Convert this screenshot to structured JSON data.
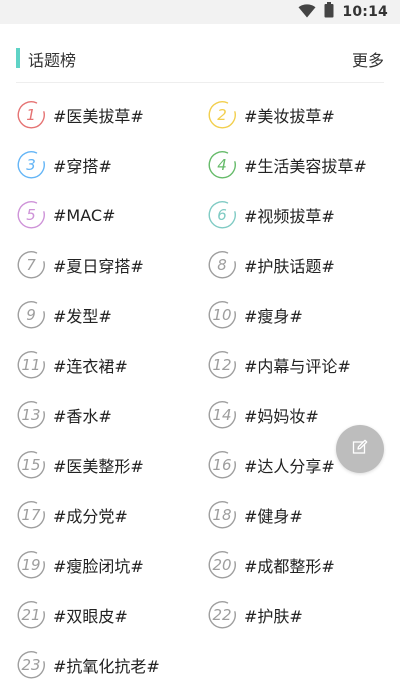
{
  "status_bar": {
    "time": "10:14",
    "icons": [
      "wifi-icon",
      "battery-icon"
    ]
  },
  "header": {
    "title": "话题榜",
    "more_label": "更多",
    "accent_color": "#5fd3c6"
  },
  "topics": [
    {
      "rank": "1",
      "label": "#医美拔草#",
      "color": "#e57373"
    },
    {
      "rank": "2",
      "label": "#美妆拔草#",
      "color": "#f2cf4e"
    },
    {
      "rank": "3",
      "label": "#穿搭#",
      "color": "#64b5f6"
    },
    {
      "rank": "4",
      "label": "#生活美容拔草#",
      "color": "#66bb6a"
    },
    {
      "rank": "5",
      "label": "#MAC#",
      "color": "#ce93d8"
    },
    {
      "rank": "6",
      "label": "#视频拔草#",
      "color": "#80cbc4"
    },
    {
      "rank": "7",
      "label": "#夏日穿搭#",
      "color": "#9e9e9e"
    },
    {
      "rank": "8",
      "label": "#护肤话题#",
      "color": "#9e9e9e"
    },
    {
      "rank": "9",
      "label": "#发型#",
      "color": "#9e9e9e"
    },
    {
      "rank": "10",
      "label": "#瘦身#",
      "color": "#9e9e9e"
    },
    {
      "rank": "11",
      "label": "#连衣裙#",
      "color": "#9e9e9e"
    },
    {
      "rank": "12",
      "label": "#内幕与评论#",
      "color": "#9e9e9e"
    },
    {
      "rank": "13",
      "label": "#香水#",
      "color": "#9e9e9e"
    },
    {
      "rank": "14",
      "label": "#妈妈妆#",
      "color": "#9e9e9e"
    },
    {
      "rank": "15",
      "label": "#医美整形#",
      "color": "#9e9e9e"
    },
    {
      "rank": "16",
      "label": "#达人分享#",
      "color": "#9e9e9e"
    },
    {
      "rank": "17",
      "label": "#成分党#",
      "color": "#9e9e9e"
    },
    {
      "rank": "18",
      "label": "#健身#",
      "color": "#9e9e9e"
    },
    {
      "rank": "19",
      "label": "#瘦脸闭坑#",
      "color": "#9e9e9e"
    },
    {
      "rank": "20",
      "label": "#成都整形#",
      "color": "#9e9e9e"
    },
    {
      "rank": "21",
      "label": "#双眼皮#",
      "color": "#9e9e9e"
    },
    {
      "rank": "22",
      "label": "#护肤#",
      "color": "#9e9e9e"
    },
    {
      "rank": "23",
      "label": "#抗氧化抗老#",
      "color": "#9e9e9e"
    }
  ],
  "fab": {
    "icon": "edit-icon",
    "color": "#bdbdbd"
  }
}
